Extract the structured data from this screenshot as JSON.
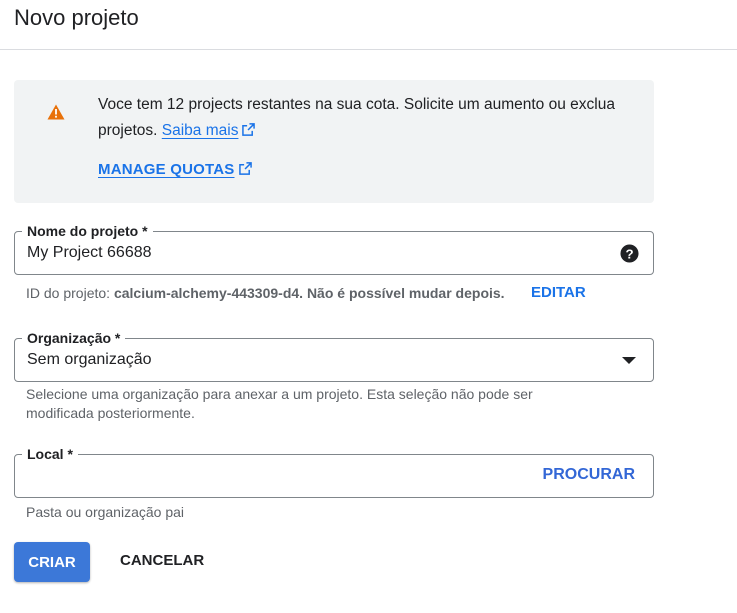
{
  "header": {
    "title": "Novo projeto"
  },
  "quota": {
    "message": "Voce tem 12 projects restantes na sua cota. Solicite um aumento ou exclua projetos.",
    "learn_more": "Saiba mais",
    "manage_quotas": "MANAGE QUOTAS"
  },
  "project_name": {
    "label": "Nome do projeto *",
    "value": "My Project 66688"
  },
  "project_id": {
    "prefix": "ID do projeto:",
    "value": "calcium-alchemy-443309-d4. Não é possível mudar depois.",
    "edit_label": "EDITAR"
  },
  "organization": {
    "label": "Organização *",
    "value": "Sem organização",
    "hint": "Selecione uma organização para anexar a um projeto. Esta seleção não pode ser modificada posteriormente."
  },
  "location": {
    "label": "Local *",
    "value": "",
    "browse_label": "PROCURAR",
    "hint": "Pasta ou organização pai"
  },
  "actions": {
    "create_label": "CRIAR",
    "cancel_label": "CANCELAR"
  },
  "icons": {
    "warning": "warning-icon",
    "external": "open-in-new-icon",
    "help": "help-icon",
    "dropdown": "arrow-drop-down-icon"
  },
  "colors": {
    "accent": "#1a73e8",
    "primary_button": "#3c78d8",
    "warning": "#e8710a"
  }
}
